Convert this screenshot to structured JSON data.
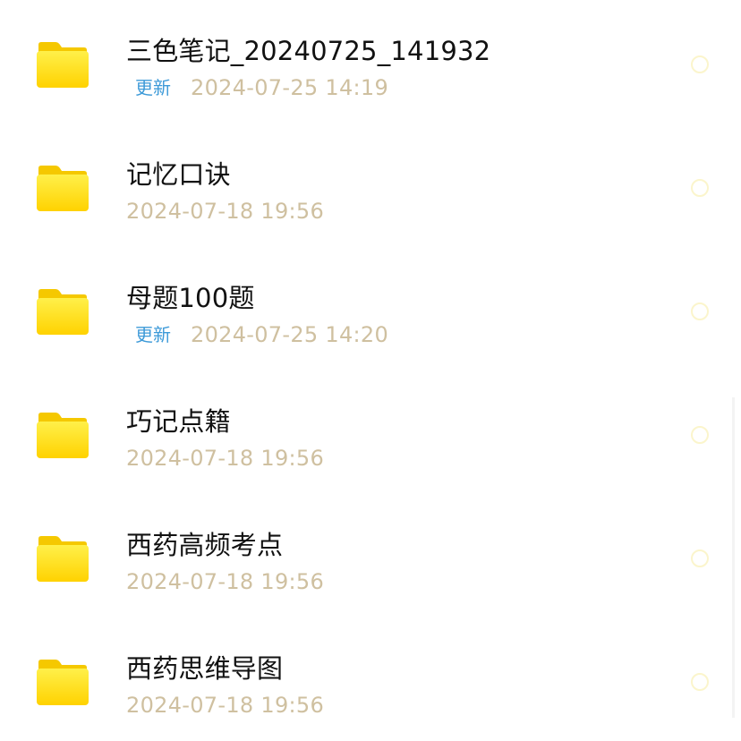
{
  "folders": [
    {
      "name": "三色笔记_20240725_141932",
      "badge": "更新",
      "time": "2024-07-25 14:19"
    },
    {
      "name": "记忆口诀",
      "badge": "",
      "time": "2024-07-18 19:56"
    },
    {
      "name": "母题100题",
      "badge": "更新",
      "time": "2024-07-25 14:20"
    },
    {
      "name": "巧记点籍",
      "badge": "",
      "time": "2024-07-18 19:56"
    },
    {
      "name": "西药高频考点",
      "badge": "",
      "time": "2024-07-18 19:56"
    },
    {
      "name": "西药思维导图",
      "badge": "",
      "time": "2024-07-18 19:56"
    }
  ],
  "colors": {
    "folder": "#FFE000",
    "badge": "#3D9AD8",
    "time": "#CFC0A0",
    "title": "#111111"
  },
  "icons": {
    "folder": "folder-icon",
    "select": "select-radio"
  }
}
